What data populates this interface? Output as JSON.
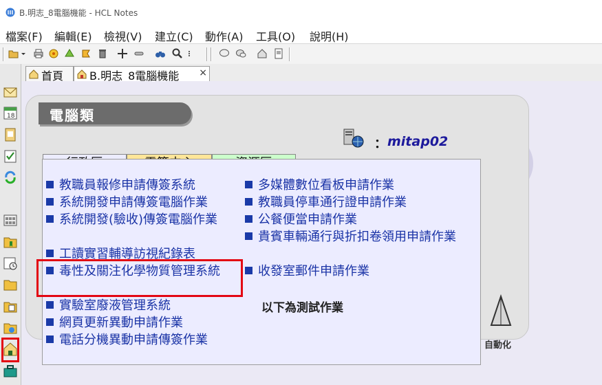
{
  "window": {
    "title": "B.明志_8電腦機能 - HCL Notes"
  },
  "menu": [
    "檔案(F)",
    "編輯(E)",
    "檢視(V)",
    "建立(C)",
    "動作(A)",
    "工具(O)",
    "說明(H)"
  ],
  "tabs": [
    {
      "label": "首頁"
    },
    {
      "label": "B.明志_8電腦機能",
      "close": "×"
    }
  ],
  "panel": {
    "title": "電腦類",
    "colon": "：",
    "user": "mitap02",
    "auto_label": "自動化"
  },
  "subtabs": [
    {
      "label": "行政區",
      "color": "#ececff"
    },
    {
      "label": "電算中心",
      "color": "#ffe699"
    },
    {
      "label": "資源區",
      "color": "#ccffcc"
    }
  ],
  "left_items": [
    "教職員報修申請傳簽系統",
    "系統開發申請傳簽電腦作業",
    "系統開發(驗收)傳簽電腦作業",
    "工讀實習輔導訪視紀錄表",
    "毒性及關注化學物質管理系統",
    "實驗室廢液管理系統",
    "網頁更新異動申請作業",
    "電話分機異動申請傳簽作業"
  ],
  "right_items": [
    "多媒體數位看板申請作業",
    "教職員停車通行證申請作業",
    "公餐便當申請作業",
    "貴賓車輛通行與折扣卷領用申請作業",
    "收發室郵件申請作業"
  ],
  "test_label": "以下為測試作業",
  "colors": {
    "link": "#1a33a6",
    "highlight": "#e30613",
    "user": "#1d1a9c"
  }
}
